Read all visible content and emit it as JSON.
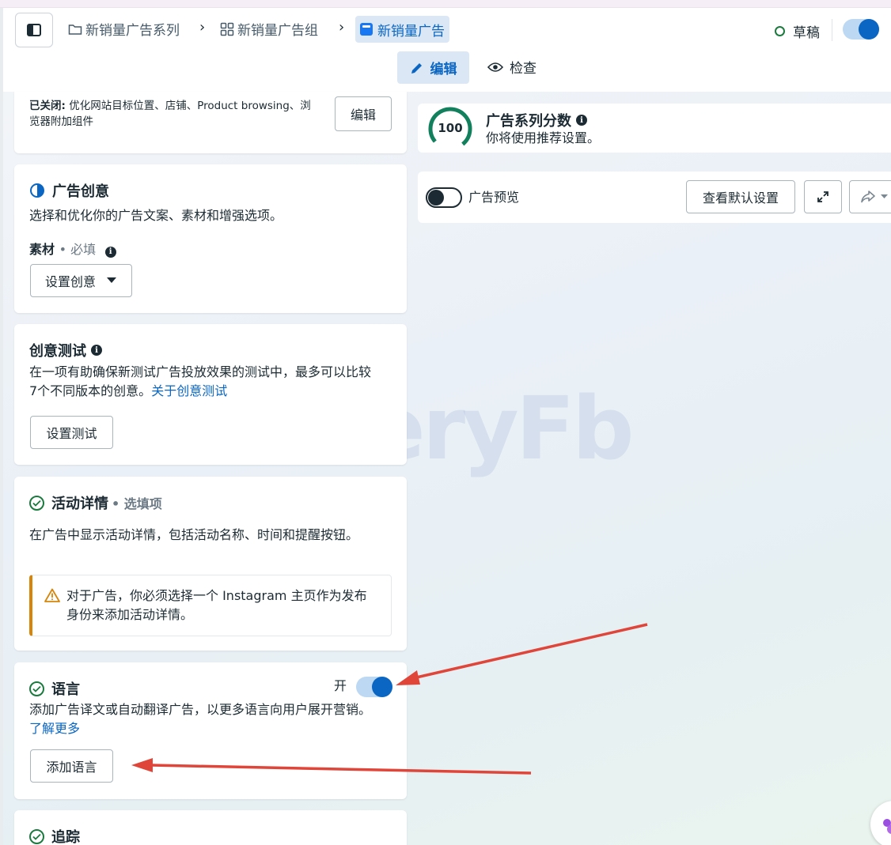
{
  "header": {
    "breadcrumb": {
      "campaign": "新销量广告系列",
      "adset": "新销量广告组",
      "ad": "新销量广告"
    },
    "status": "草稿",
    "tabs": {
      "edit": "编辑",
      "review": "检查"
    }
  },
  "top_card": {
    "disabled_prefix": "已关闭:",
    "disabled_line1": "优化网站目标位置、店铺、Product browsing、浏",
    "disabled_line2": "览器附加组件",
    "edit_button": "编辑"
  },
  "creative_card": {
    "title": "广告创意",
    "description": "选择和优化你的广告文案、素材和增强选项。",
    "media_label": "素材",
    "required": "• 必填",
    "setup_button": "设置创意"
  },
  "creative_test_card": {
    "title": "创意测试",
    "desc_line1": "在一项有助确保新测试广告投放效果的测试中，最多可以比较",
    "desc_line2": "7个不同版本的创意。",
    "link": "关于创意测试",
    "setup_button": "设置测试"
  },
  "event_card": {
    "title": "活动详情",
    "optional": "• 选填项",
    "description": "在广告中显示活动详情，包括活动名称、时间和提醒按钮。",
    "warning_line1": "对于广告，你必须选择一个 Instagram 主页作为发布",
    "warning_line2": "身份来添加活动详情。"
  },
  "language_card": {
    "title": "语言",
    "toggle_label": "开",
    "toggle_on": true,
    "description": "添加广告译文或自动翻译广告，以更多语言向用户展开营销。",
    "learn_more": "了解更多",
    "add_button": "添加语言"
  },
  "tracking_card": {
    "title": "追踪"
  },
  "score_panel": {
    "score": "100",
    "title": "广告系列分数",
    "subtitle": "你将使用推荐设置。"
  },
  "preview_panel": {
    "toggle_label": "广告预览",
    "toggle_on": false,
    "default_settings_button": "查看默认设置"
  },
  "watermark": "VeryFb",
  "colors": {
    "accent": "#0a66c2",
    "success": "#1b7a3e",
    "warning": "#d6850a",
    "arrow": "#e0453a"
  }
}
